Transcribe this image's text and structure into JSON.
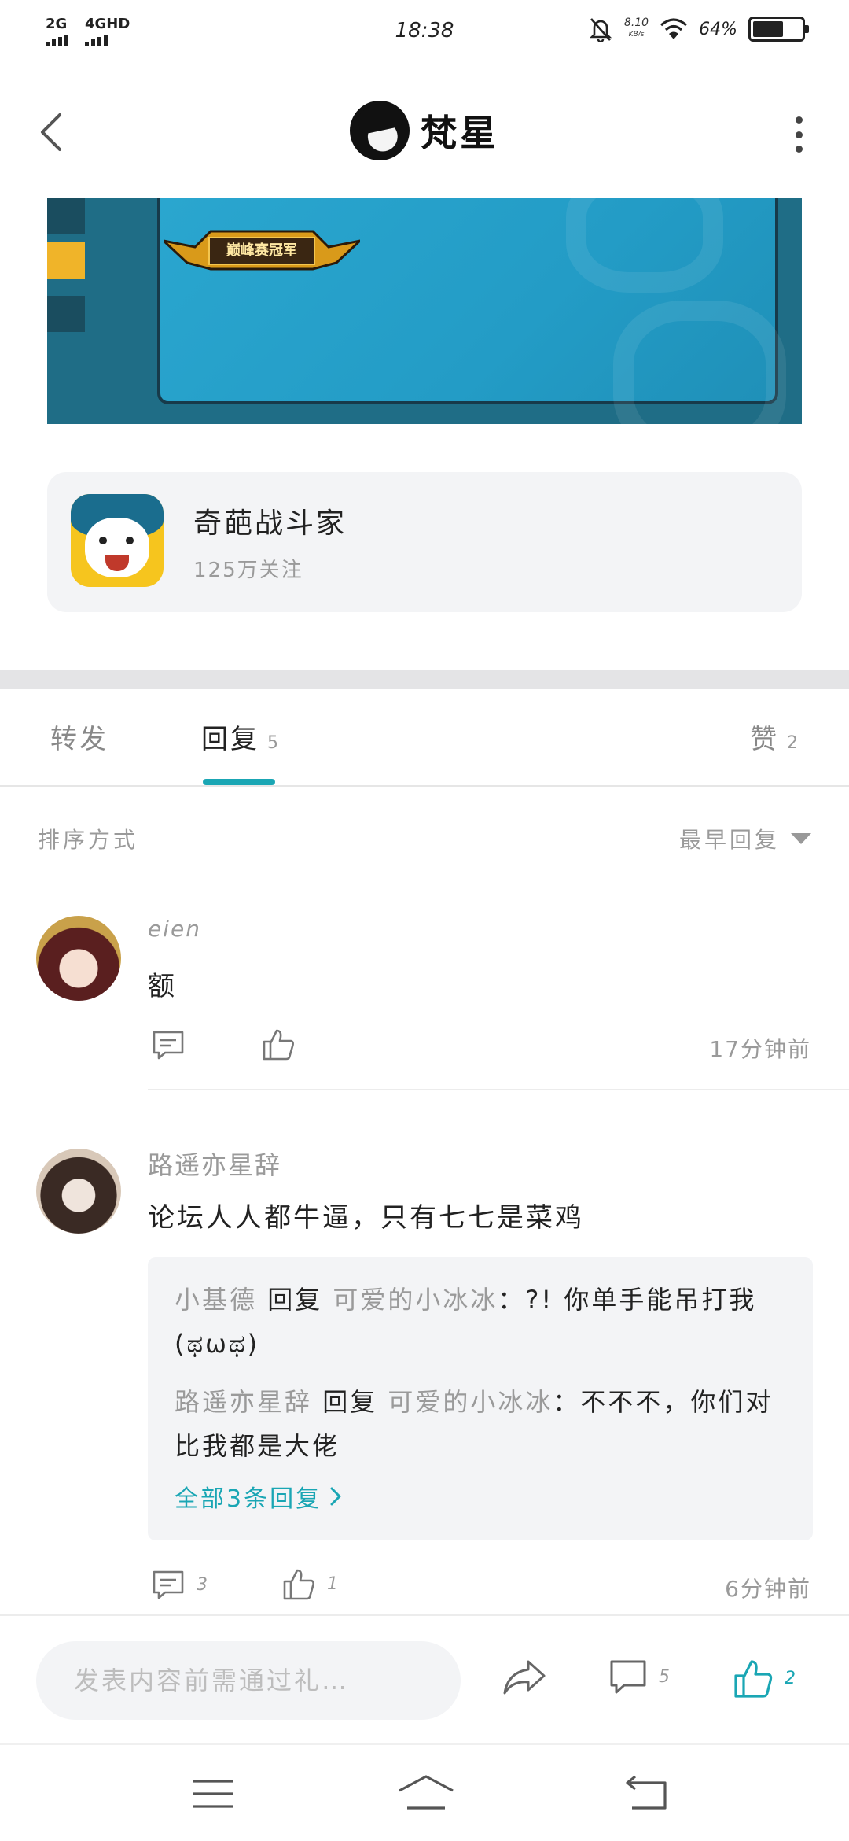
{
  "status_bar": {
    "signal_1": "2G",
    "signal_2": "4GHD",
    "time": "18:38",
    "net_speed_value": "8.10",
    "net_speed_unit": "KB/s",
    "battery_pct": "64%",
    "battery_level": 0.64
  },
  "header": {
    "title": "梵星"
  },
  "banner": {
    "badge_text": "巅峰赛冠军"
  },
  "game_card": {
    "name": "奇葩战斗家",
    "followers": "125万关注"
  },
  "tabs": [
    {
      "label": "转发",
      "count": ""
    },
    {
      "label": "回复",
      "count": "5"
    },
    {
      "label": "赞",
      "count": "2"
    }
  ],
  "sort": {
    "label": "排序方式",
    "selected": "最早回复"
  },
  "comments": [
    {
      "user": "eien",
      "text": "额",
      "reply_count": "",
      "like_count": "",
      "time": "17分钟前"
    },
    {
      "user": "路遥亦星辞",
      "text": "论坛人人都牛逼，只有七七是菜鸡",
      "reply_count": "3",
      "like_count": "1",
      "time": "6分钟前",
      "replies": [
        {
          "from": "小基德",
          "verb": "回复",
          "to": "可爱的小冰冰",
          "text": "：?! 你单手能吊打我(ಥωಥ)"
        },
        {
          "from": "路遥亦星辞",
          "verb": "回复",
          "to": "可爱的小冰冰",
          "text": "：不不不，你们对比我都是大佬"
        }
      ],
      "all_replies": "全部3条回复"
    }
  ],
  "bottom_bar": {
    "placeholder": "发表内容前需通过礼…",
    "comment_count": "5",
    "like_count": "2"
  },
  "colors": {
    "accent": "#1aa6b4",
    "muted": "#9a9a9a",
    "card_bg": "#f3f4f6"
  }
}
